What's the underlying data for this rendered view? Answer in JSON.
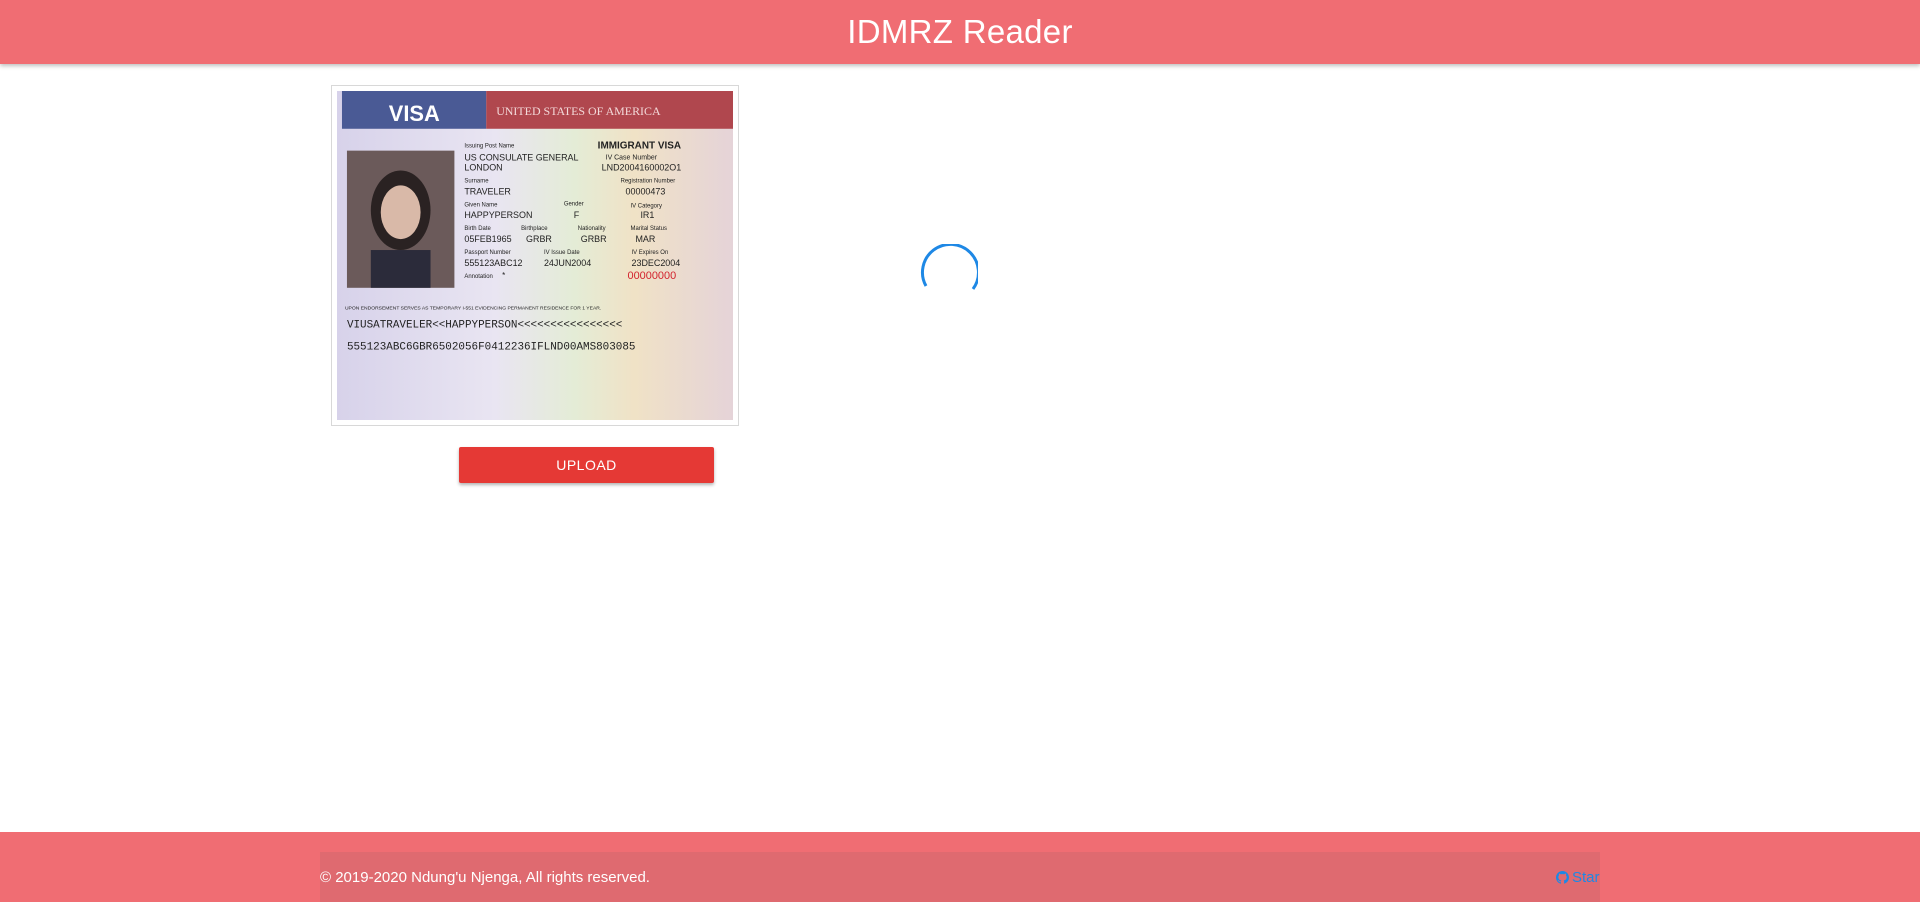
{
  "header": {
    "title": "IDMRZ Reader"
  },
  "document": {
    "top_banner": "VISA",
    "country_banner": "UNITED STATES OF AMERICA",
    "issuing_post_label": "Issuing Post Name",
    "issuing_post_line1": "US CONSULATE GENERAL",
    "issuing_post_line2": "LONDON",
    "visa_type": "IMMIGRANT VISA",
    "case_number_label": "IV Case Number",
    "case_number": "LND2004160002O1",
    "registration_label": "Registration Number",
    "registration": "00000473",
    "surname_label": "Surname",
    "surname": "TRAVELER",
    "given_label": "Given Name",
    "given": "HAPPYPERSON",
    "gender_label": "Gender",
    "gender": "F",
    "category_label": "IV Category",
    "category": "IR1",
    "birth_date_label": "Birth Date",
    "birth_date": "05FEB1965",
    "birthplace_label": "Birthplace",
    "birthplace": "GRBR",
    "nationality_label": "Nationality",
    "nationality": "GRBR",
    "marital_label": "Marital Status",
    "marital": "MAR",
    "passport_label": "Passport Number",
    "passport": "555123ABC12",
    "issue_label": "IV Issue Date",
    "issue_date": "24JUN2004",
    "expires_label": "IV Expires On",
    "expires": "23DEC2004",
    "control_number": "00000000",
    "annotation_label": "Annotation",
    "annotation": "*",
    "endorsement": "UPON ENDORSEMENT SERVES AS TEMPORARY I-551 EVIDENCING PERMANENT RESIDENCE FOR 1 YEAR.",
    "mrz_line1": "VIUSATRAVELER<<HAPPYPERSON<<<<<<<<<<<<<<<<",
    "mrz_line2": "555123ABC6GBR6502056F0412236IFLND00AMS803085"
  },
  "upload": {
    "label": "UPLOAD"
  },
  "footer": {
    "copyright": "© 2019-2020 Ndung'u Njenga, All rights reserved.",
    "star_label": "Star"
  },
  "colors": {
    "header_bg": "#f06d73",
    "button_bg": "#e53935",
    "spinner": "#1e88e5",
    "link": "#1e88e5"
  }
}
